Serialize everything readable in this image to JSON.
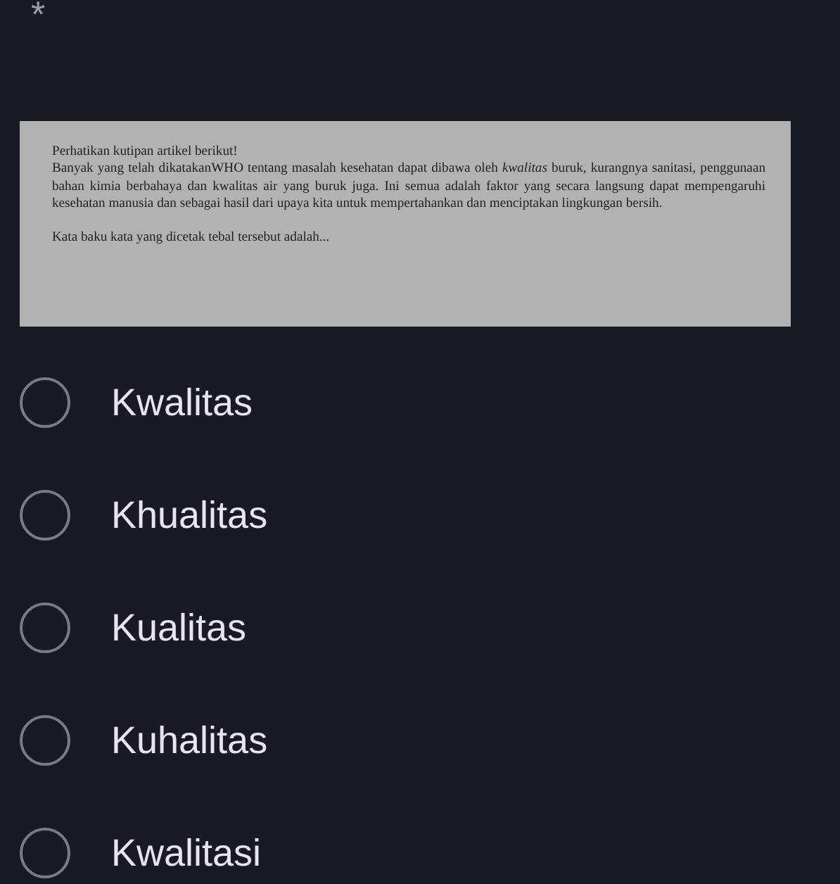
{
  "required_mark": "*",
  "article_image": {
    "intro": "Perhatikan kutipan artikel berikut!",
    "paragraph": "Banyak yang telah dikatakanWHO  tentang masalah kesehatan dapat dibawa oleh *kwalitas* buruk, kurangnya sanitasi, penggunaan bahan kimia berbahaya dan kwalitas air yang buruk juga. Ini semua adalah faktor yang secara langsung dapat mempengaruhi kesehatan manusia dan sebagai hasil dari upaya kita untuk mempertahankan dan menciptakan lingkungan bersih.",
    "question": "Kata baku kata yang dicetak tebal tersebut adalah..."
  },
  "options": [
    {
      "label": "Kwalitas",
      "selected": false
    },
    {
      "label": "Khualitas",
      "selected": false
    },
    {
      "label": "Kualitas",
      "selected": false
    },
    {
      "label": "Kuhalitas",
      "selected": false
    },
    {
      "label": "Kwalitasi",
      "selected": false
    }
  ]
}
